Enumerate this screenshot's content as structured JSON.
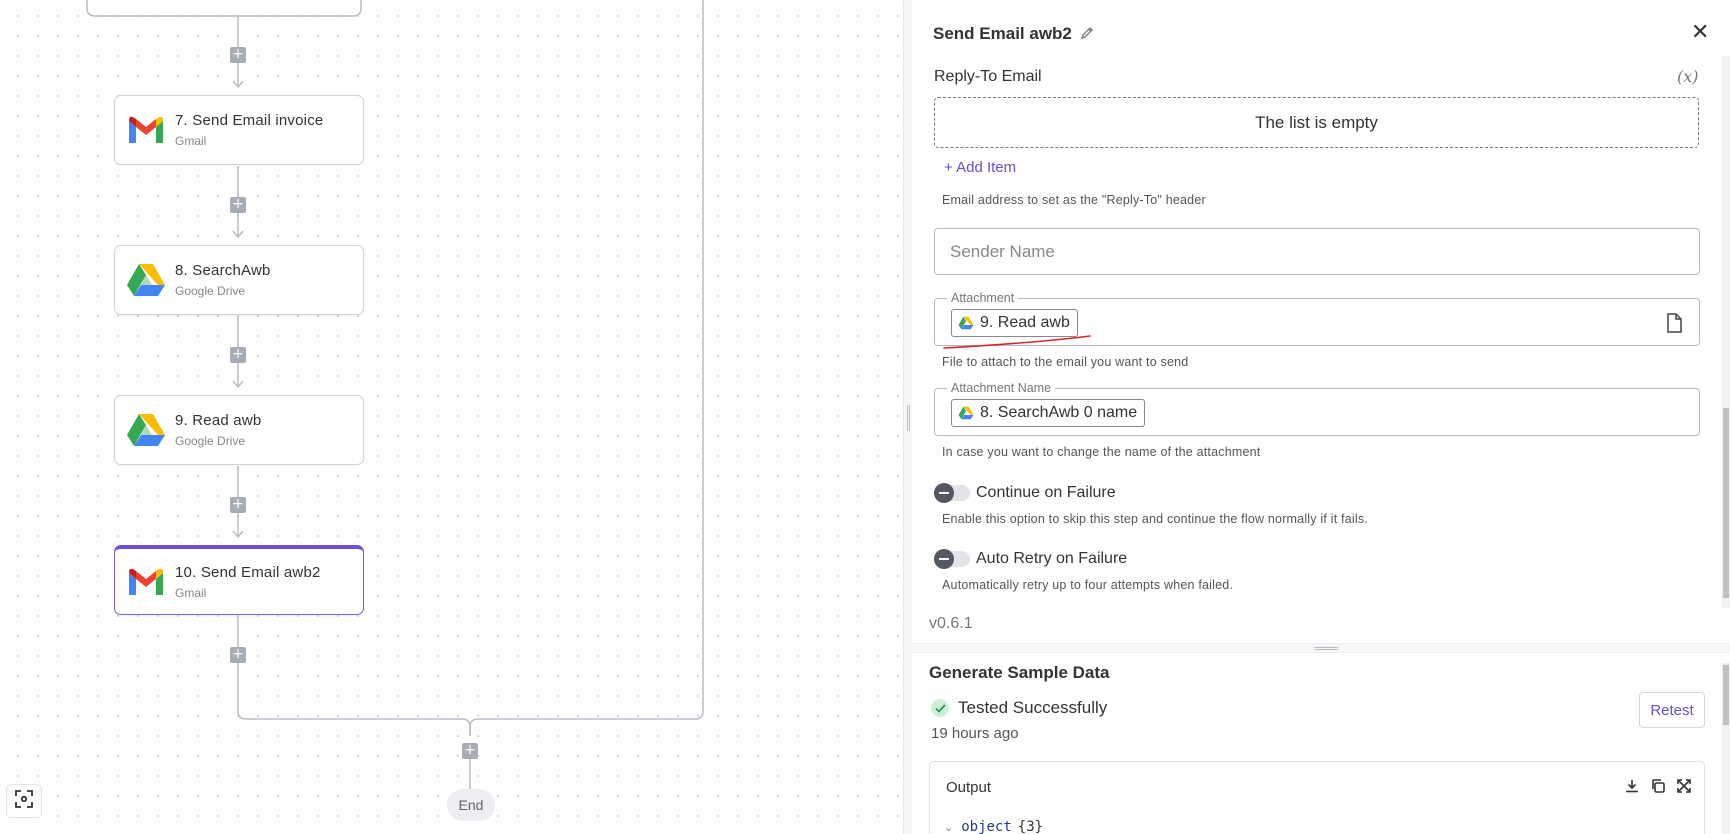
{
  "flow": {
    "nodes": [
      {
        "title": "7. Send Email invoice",
        "app": "Gmail",
        "icon": "gmail-icon"
      },
      {
        "title": "8. SearchAwb",
        "app": "Google Drive",
        "icon": "google-drive-icon"
      },
      {
        "title": "9. Read awb",
        "app": "Google Drive",
        "icon": "google-drive-icon"
      },
      {
        "title": "10. Send Email awb2",
        "app": "Gmail",
        "icon": "gmail-icon",
        "selected": true
      }
    ],
    "add_step_symbol": "+",
    "end_label": "End"
  },
  "panel": {
    "title": "Send Email awb2",
    "close_symbol": "✕",
    "reply_to": {
      "label": "Reply-To Email",
      "dynamic_toggle": "(x)",
      "empty_text": "The list is empty",
      "add_item": "+ Add Item",
      "hint": "Email address to set as the \"Reply-To\" header"
    },
    "sender_name": {
      "placeholder": "Sender Name",
      "value": ""
    },
    "attachment": {
      "label": "Attachment",
      "chip": "9. Read awb",
      "hint": "File to attach to the email you want to send"
    },
    "attachment_name": {
      "label": "Attachment Name",
      "chip": "8. SearchAwb 0 name",
      "hint": "In case you want to change the name of the attachment"
    },
    "continue_on_failure": {
      "label": "Continue on Failure",
      "hint": "Enable this option to skip this step and continue the flow normally if it fails.",
      "enabled": false
    },
    "auto_retry": {
      "label": "Auto Retry on Failure",
      "hint": "Automatically retry up to four attempts when failed.",
      "enabled": false
    },
    "version": "v0.6.1"
  },
  "sample_data": {
    "title": "Generate Sample Data",
    "status": "Tested Successfully",
    "time_ago": "19 hours ago",
    "retest_label": "Retest",
    "output": {
      "label": "Output",
      "root_key": "object",
      "root_count": "{3}"
    }
  },
  "colors": {
    "accent": "#6a4fd1",
    "selected_border": "#6f4fd6",
    "annotation_red": "#d62828",
    "success": "#1f9d55"
  }
}
